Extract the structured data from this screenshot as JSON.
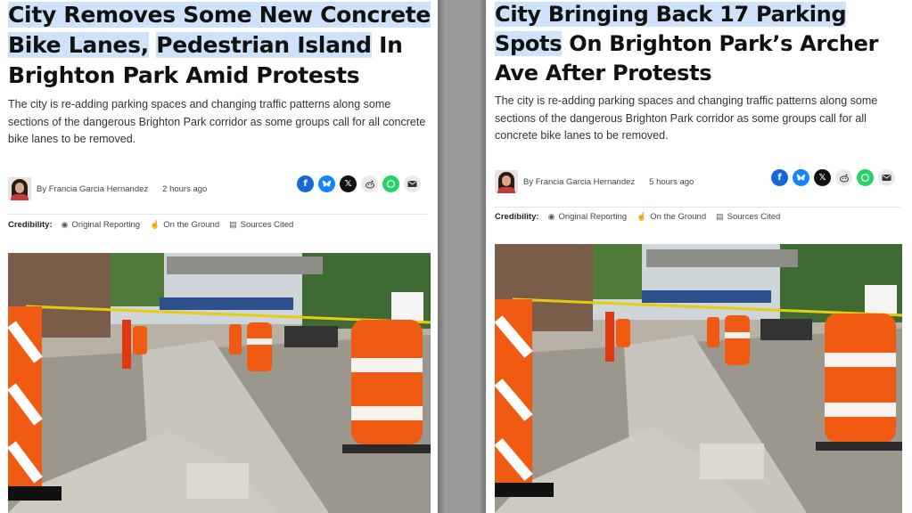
{
  "left_article": {
    "headline_parts": [
      "City Removes Some New Concrete Bike Lanes,",
      " ",
      "Pedestrian Island",
      " In Brighton Park Amid Protests"
    ],
    "dek": "The city is re-adding parking spaces and changing traffic patterns along some sections of the dangerous Brighton Park corridor as some groups call for all concrete bike lanes to be removed.",
    "byline": "By Francia Garcia Hernandez",
    "time": "2 hours ago",
    "credibility_label": "Credibility:",
    "credibility_items": [
      "Original Reporting",
      "On the Ground",
      "Sources Cited"
    ]
  },
  "right_article": {
    "headline_parts": [
      "City Bringing Back 17 Parking Spots",
      " On Brighton Park’s Archer Ave After Protests"
    ],
    "dek": "The city is re-adding parking spaces and changing traffic patterns along some sections of the dangerous Brighton Park corridor as some groups call for all concrete bike lanes to be removed.",
    "byline": "By Francia Garcia Hernandez",
    "time": "5 hours ago",
    "credibility_label": "Credibility:",
    "credibility_items": [
      "Original Reporting",
      "On the Ground",
      "Sources Cited"
    ]
  },
  "share_icons": [
    "facebook-icon",
    "bluesky-icon",
    "x-icon",
    "reddit-icon",
    "whatsapp-icon",
    "mail-icon"
  ],
  "credibility_icons": [
    "eye-icon",
    "hand-icon",
    "document-icon"
  ],
  "colors": {
    "highlight": "#cfe2fb",
    "facebook": "#1668d8",
    "bluesky": "#1185fe",
    "whatsapp": "#25d366",
    "cone_orange": "#f05a12"
  }
}
